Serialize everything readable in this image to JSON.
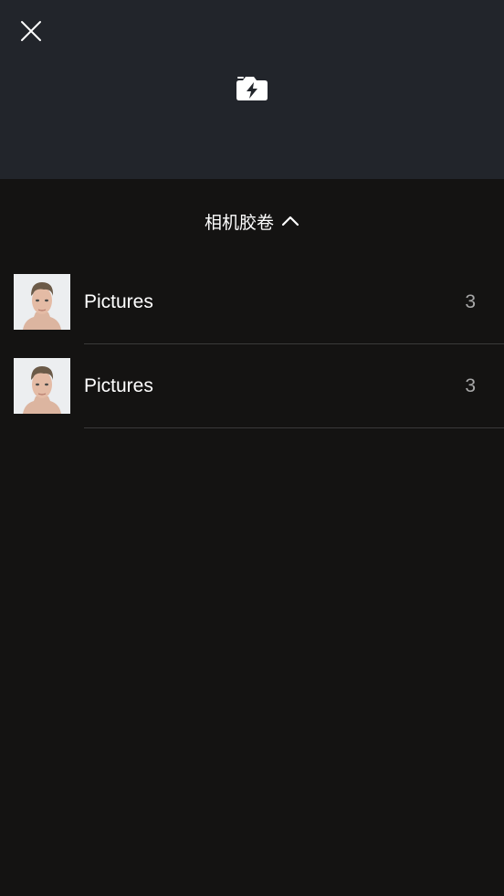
{
  "top_bar": {
    "close_icon": "close-icon",
    "camera_icon": "camera-flash-icon"
  },
  "album_picker": {
    "title": "相机胶卷",
    "toggle_icon": "chevron-up-icon"
  },
  "albums": [
    {
      "name": "Pictures",
      "count": "3",
      "thumbnail": "portrait-photo"
    },
    {
      "name": "Pictures",
      "count": "3",
      "thumbnail": "portrait-photo"
    }
  ],
  "colors": {
    "top_bar_bg": "#22252b",
    "body_bg": "#141312",
    "text_primary": "#ffffff",
    "text_secondary": "#a8a8a8",
    "divider": "#3a3a3a"
  }
}
